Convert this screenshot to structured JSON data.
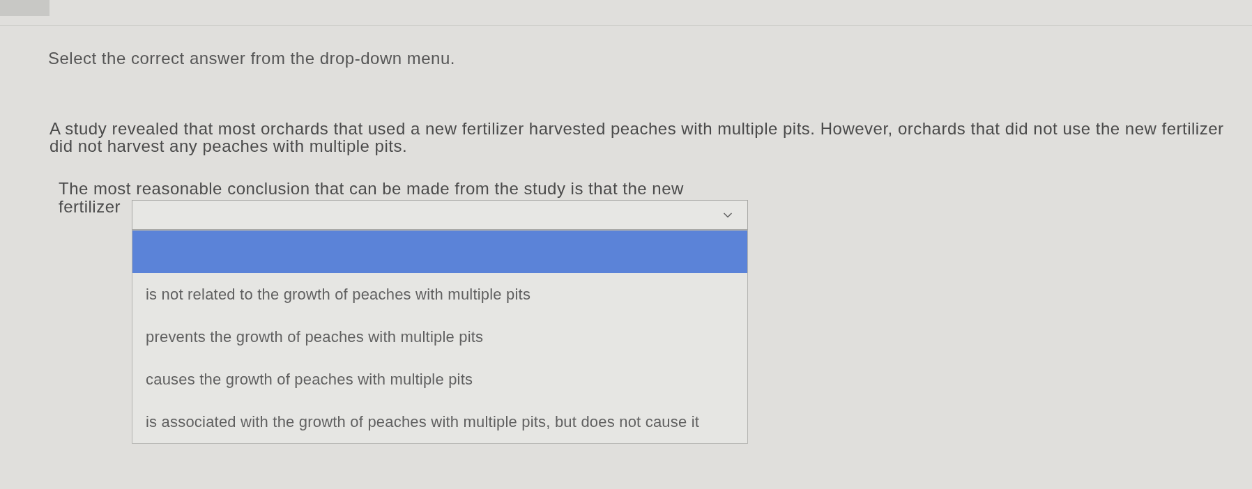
{
  "instruction": "Select the correct answer from the drop-down menu.",
  "passage": "A study revealed that most orchards that used a new fertilizer harvested peaches with multiple pits. However, orchards that did not use the new fertilizer did not harvest any peaches with multiple pits.",
  "question": {
    "text_lines": [
      "The most reasonable conclusion that can be made from the study is that the new",
      "fertilizer"
    ],
    "dropdown": {
      "expanded": true,
      "options": [
        {
          "selected": true
        },
        {
          "label": "is not related to the growth of peaches with multiple pits",
          "selected": false
        },
        {
          "label": "prevents the growth of peaches with multiple pits",
          "selected": false
        },
        {
          "label": "causes the growth of peaches with multiple pits",
          "selected": false
        },
        {
          "label": "is associated with the growth of peaches with multiple pits, but does not cause it",
          "selected": false
        }
      ]
    }
  }
}
